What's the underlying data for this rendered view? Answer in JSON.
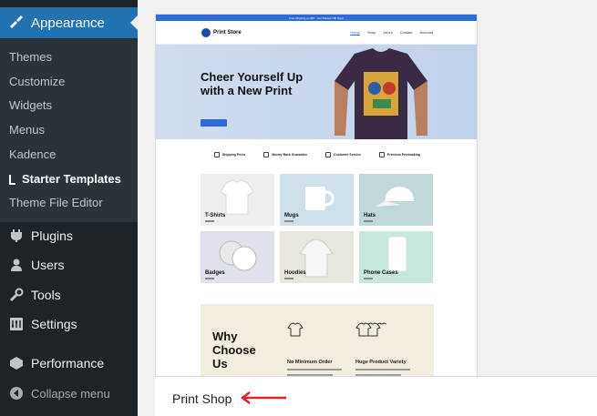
{
  "sidebar": {
    "active": {
      "label": "Appearance",
      "icon": "paintbrush-icon"
    },
    "submenu": [
      "Themes",
      "Customize",
      "Widgets",
      "Menus",
      "Kadence",
      "Starter Templates",
      "Theme File Editor"
    ],
    "items": [
      {
        "label": "Plugins",
        "icon": "plug-icon"
      },
      {
        "label": "Users",
        "icon": "user-icon"
      },
      {
        "label": "Tools",
        "icon": "wrench-icon"
      },
      {
        "label": "Settings",
        "icon": "settings-icon"
      },
      {
        "label": "Performance",
        "icon": "performance-icon"
      },
      {
        "label": "Collapse menu",
        "icon": "collapse-icon"
      }
    ]
  },
  "preview": {
    "topbar_text": "Free shipping on $60 · Get Started 100 Days",
    "brand": "Print Store",
    "nav": [
      "Home",
      "Shop",
      "About",
      "Contact",
      "Account"
    ],
    "hero_title": "Cheer Yourself Up with a New Print",
    "features": [
      "Shipping Perks",
      "Money Back Guarantee",
      "Customer Service",
      "Premium Printmaking"
    ],
    "categories": [
      "T-Shirts",
      "Mugs",
      "Hats",
      "Badges",
      "Hoodies",
      "Phone Cases"
    ],
    "why_title": "Why Choose Us",
    "why_cols": [
      "No Minimum Order",
      "Huge Product Variety"
    ]
  },
  "template_name": "Print Shop",
  "colors": {
    "accent": "#2271b1",
    "arrow": "#d9232d",
    "sidebar": "#1d2327"
  }
}
